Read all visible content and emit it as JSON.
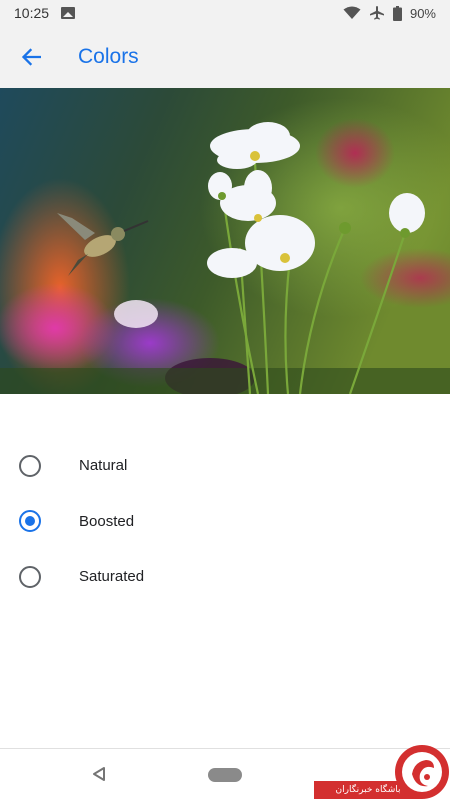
{
  "status_bar": {
    "time": "10:25",
    "battery": "90%",
    "icons": [
      "gallery-icon",
      "wifi-icon",
      "airplane-icon",
      "battery-icon"
    ]
  },
  "app_bar": {
    "title": "Colors",
    "back_icon": "arrow-left-icon"
  },
  "colors": {
    "accent": "#1a73e8",
    "radio_unchecked": "#5f6368",
    "bar_background": "#f2f2f2"
  },
  "color_modes": [
    {
      "label": "Natural",
      "selected": false
    },
    {
      "label": "Boosted",
      "selected": true
    },
    {
      "label": "Saturated",
      "selected": false
    }
  ],
  "nav_bar": {
    "back_icon": "triangle-back-icon",
    "home_icon": "pill-home-icon"
  },
  "watermark": {
    "text": "باشگاه خبرنگاران"
  }
}
